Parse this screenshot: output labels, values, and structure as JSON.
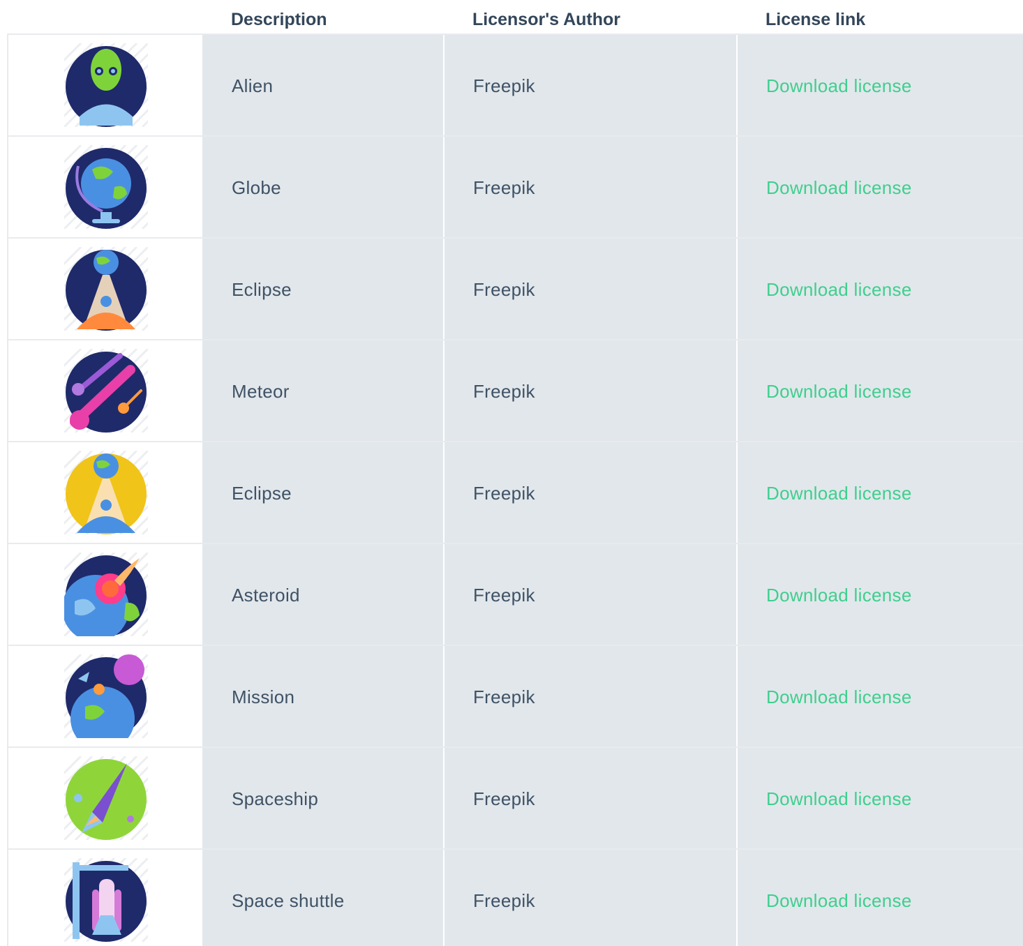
{
  "table": {
    "headers": {
      "description": "Description",
      "author": "Licensor's Author",
      "link": "License link"
    },
    "rows": [
      {
        "icon": "alien-icon",
        "description": "Alien",
        "author": "Freepik",
        "link": "Download license",
        "bg": "#1f2a6b",
        "accent": "#7fd33a"
      },
      {
        "icon": "globe-icon",
        "description": "Globe",
        "author": "Freepik",
        "link": "Download license",
        "bg": "#1f2a6b",
        "accent": "#4a90e2"
      },
      {
        "icon": "eclipse-icon",
        "description": "Eclipse",
        "author": "Freepik",
        "link": "Download license",
        "bg": "#1f2a6b",
        "accent": "#ff8a3d"
      },
      {
        "icon": "meteor-icon",
        "description": "Meteor",
        "author": "Freepik",
        "link": "Download license",
        "bg": "#1f2a6b",
        "accent": "#e83fa8"
      },
      {
        "icon": "eclipse-icon",
        "description": "Eclipse",
        "author": "Freepik",
        "link": "Download license",
        "bg": "#f0c419",
        "accent": "#4a90e2"
      },
      {
        "icon": "asteroid-icon",
        "description": "Asteroid",
        "author": "Freepik",
        "link": "Download license",
        "bg": "#1f2a6b",
        "accent": "#ff3d8b"
      },
      {
        "icon": "mission-icon",
        "description": "Mission",
        "author": "Freepik",
        "link": "Download license",
        "bg": "#1f2a6b",
        "accent": "#c85ad6"
      },
      {
        "icon": "spaceship-icon",
        "description": "Spaceship",
        "author": "Freepik",
        "link": "Download license",
        "bg": "#8fd53a",
        "accent": "#7a4fd0"
      },
      {
        "icon": "space-shuttle-icon",
        "description": "Space shuttle",
        "author": "Freepik",
        "link": "Download license",
        "bg": "#1f2a6b",
        "accent": "#d67ad8"
      }
    ]
  },
  "colors": {
    "header_text": "#33465a",
    "cell_bg": "#e2e7eb",
    "cell_text": "#3f5266",
    "link": "#3ecf8e"
  }
}
